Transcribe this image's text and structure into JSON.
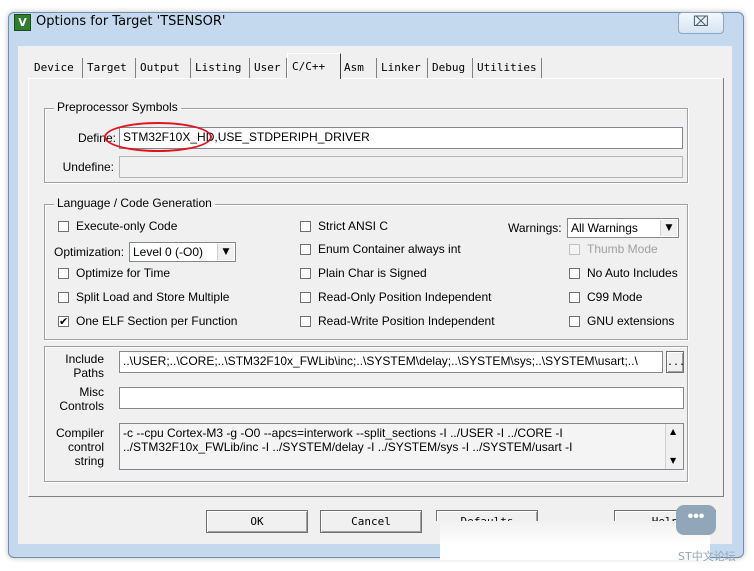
{
  "window": {
    "title": "Options for Target 'TSENSOR'",
    "close_glyph": "⌧",
    "app_icon": "uvision-icon",
    "app_icon_glyph": "V"
  },
  "tabs": [
    {
      "label": "Device",
      "active": false
    },
    {
      "label": "Target",
      "active": false
    },
    {
      "label": "Output",
      "active": false
    },
    {
      "label": "Listing",
      "active": false
    },
    {
      "label": "User",
      "active": false
    },
    {
      "label": "C/C++",
      "active": true
    },
    {
      "label": "Asm",
      "active": false
    },
    {
      "label": "Linker",
      "active": false
    },
    {
      "label": "Debug",
      "active": false
    },
    {
      "label": "Utilities",
      "active": false
    }
  ],
  "preprocessor": {
    "group_label": "Preprocessor Symbols",
    "define_label": "Define:",
    "define_value": "STM32F10X_HD,USE_STDPERIPH_DRIVER",
    "undefine_label": "Undefine:",
    "undefine_value": ""
  },
  "language": {
    "group_label": "Language / Code Generation",
    "execute_only": {
      "label": "Execute-only Code",
      "checked": false
    },
    "optimization_label": "Optimization:",
    "optimization_value": "Level 0 (-O0)",
    "optimize_time": {
      "label": "Optimize for Time",
      "checked": false
    },
    "split_load": {
      "label": "Split Load and Store Multiple",
      "checked": false
    },
    "one_elf": {
      "label": "One ELF Section per Function",
      "checked": true
    },
    "strict_ansi": {
      "label": "Strict ANSI C",
      "checked": false
    },
    "enum_container": {
      "label": "Enum Container always int",
      "checked": false
    },
    "plain_char": {
      "label": "Plain Char is Signed",
      "checked": false
    },
    "readonly_pos": {
      "label": "Read-Only Position Independent",
      "checked": false
    },
    "readwrite_pos": {
      "label": "Read-Write Position Independent",
      "checked": false
    },
    "warnings_label": "Warnings:",
    "warnings_value": "All Warnings",
    "thumb_mode": {
      "label": "Thumb Mode",
      "checked": false,
      "enabled": false
    },
    "no_auto_includes": {
      "label": "No Auto Includes",
      "checked": false
    },
    "c99_mode": {
      "label": "C99 Mode",
      "checked": false
    },
    "gnu_extensions": {
      "label": "GNU extensions",
      "checked": false
    }
  },
  "paths": {
    "include_label_1": "Include",
    "include_label_2": "Paths",
    "include_value": "..\\USER;..\\CORE;..\\STM32F10x_FWLib\\inc;..\\SYSTEM\\delay;..\\SYSTEM\\sys;..\\SYSTEM\\usart;..\\",
    "browse_label": "...",
    "misc_label_1": "Misc",
    "misc_label_2": "Controls",
    "misc_value": "",
    "compiler_label_1": "Compiler",
    "compiler_label_2": "control",
    "compiler_label_3": "string",
    "compiler_line_1": "-c --cpu Cortex-M3 -g -O0 --apcs=interwork --split_sections -I ../USER -I ../CORE -I",
    "compiler_line_2": "../STM32F10x_FWLib/inc -I ../SYSTEM/delay -I ../SYSTEM/sys -I ../SYSTEM/usart -I"
  },
  "buttons": {
    "ok": "OK",
    "cancel": "Cancel",
    "defaults": "Defaults",
    "help": "Help"
  },
  "watermark": {
    "bubble_glyph": "•••",
    "text": "ST中文论坛"
  },
  "icons": {
    "check": "✔",
    "dropdown": "▼",
    "scroll_up": "▲",
    "scroll_down": "▼"
  }
}
